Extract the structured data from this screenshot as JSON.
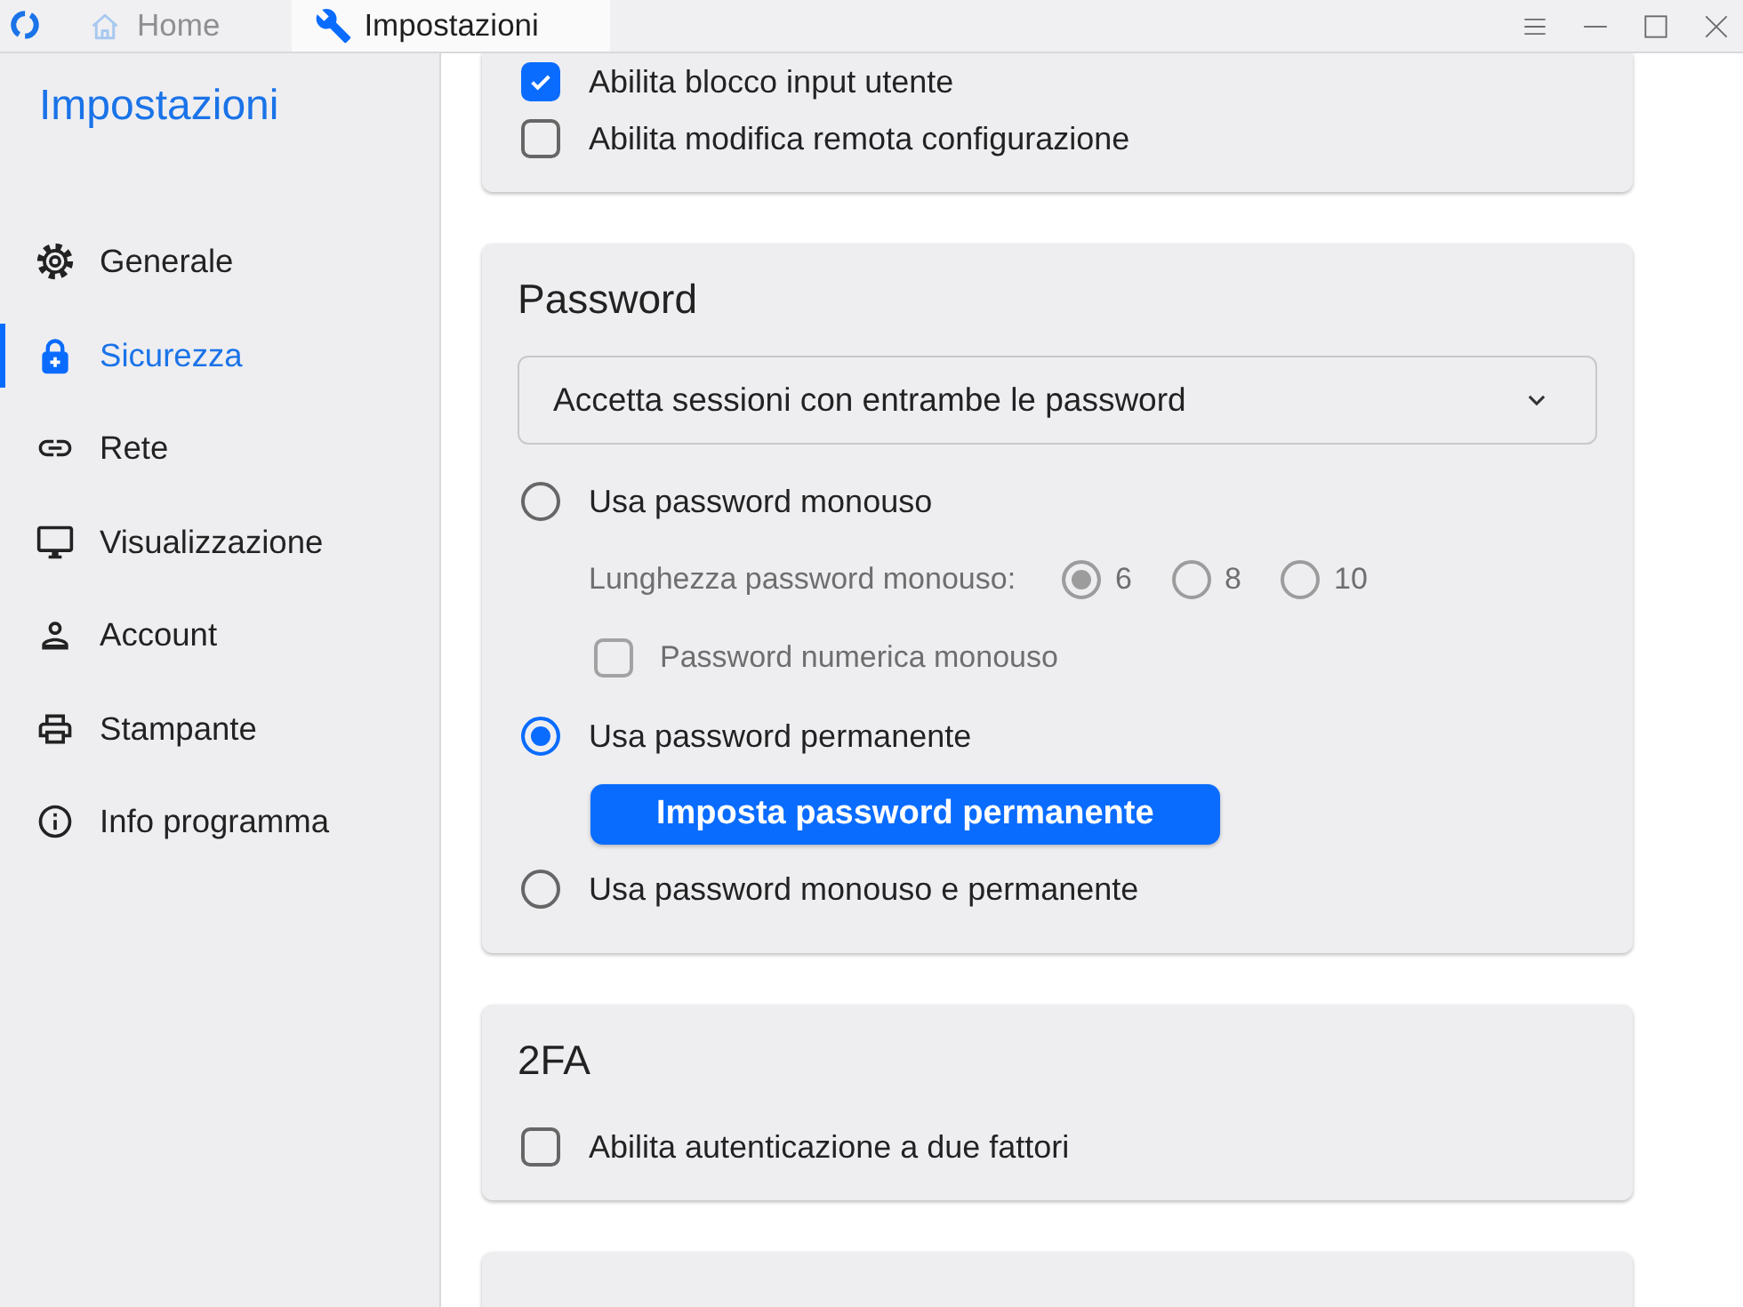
{
  "window": {
    "tabs": [
      {
        "label": "Home",
        "selected": false
      },
      {
        "label": "Impostazioni",
        "selected": true
      }
    ]
  },
  "sidebar": {
    "title": "Impostazioni",
    "items": [
      {
        "label": "Generale",
        "selected": false
      },
      {
        "label": "Sicurezza",
        "selected": true
      },
      {
        "label": "Rete",
        "selected": false
      },
      {
        "label": "Visualizzazione",
        "selected": false
      },
      {
        "label": "Account",
        "selected": false
      },
      {
        "label": "Stampante",
        "selected": false
      },
      {
        "label": "Info programma",
        "selected": false
      }
    ]
  },
  "sections": [
    {
      "kind": "card",
      "items": [
        {
          "kind": "checkbox",
          "label": "Abilita blocco input utente",
          "checked": true
        },
        {
          "kind": "checkbox",
          "label": "Abilita modifica remota configurazione",
          "checked": false
        }
      ]
    },
    {
      "kind": "card",
      "title": "Password",
      "items": [
        {
          "kind": "dropdown",
          "value": "Accetta sessioni con entrambe le password"
        },
        {
          "kind": "radio",
          "label": "Usa password monouso",
          "selected": false,
          "children": [
            {
              "kind": "choice",
              "label": "Lunghezza password monouso:",
              "disabled": true,
              "options": [
                {
                  "label": "6",
                  "selected": true
                },
                {
                  "label": "8",
                  "selected": false
                },
                {
                  "label": "10",
                  "selected": false
                }
              ]
            },
            {
              "kind": "checkbox",
              "label": "Password numerica monouso",
              "checked": false,
              "disabled": true
            }
          ]
        },
        {
          "kind": "radio",
          "label": "Usa password permanente",
          "selected": true,
          "children": [
            {
              "kind": "button",
              "label": "Imposta password permanente",
              "disabled": false
            }
          ]
        },
        {
          "kind": "radio",
          "label": "Usa password monouso e permanente",
          "selected": false
        }
      ]
    },
    {
      "kind": "card",
      "title": "2FA",
      "items": [
        {
          "kind": "checkbox",
          "label": "Abilita autenticazione a due fattori",
          "checked": false
        }
      ]
    },
    {
      "kind": "card"
    }
  ]
}
